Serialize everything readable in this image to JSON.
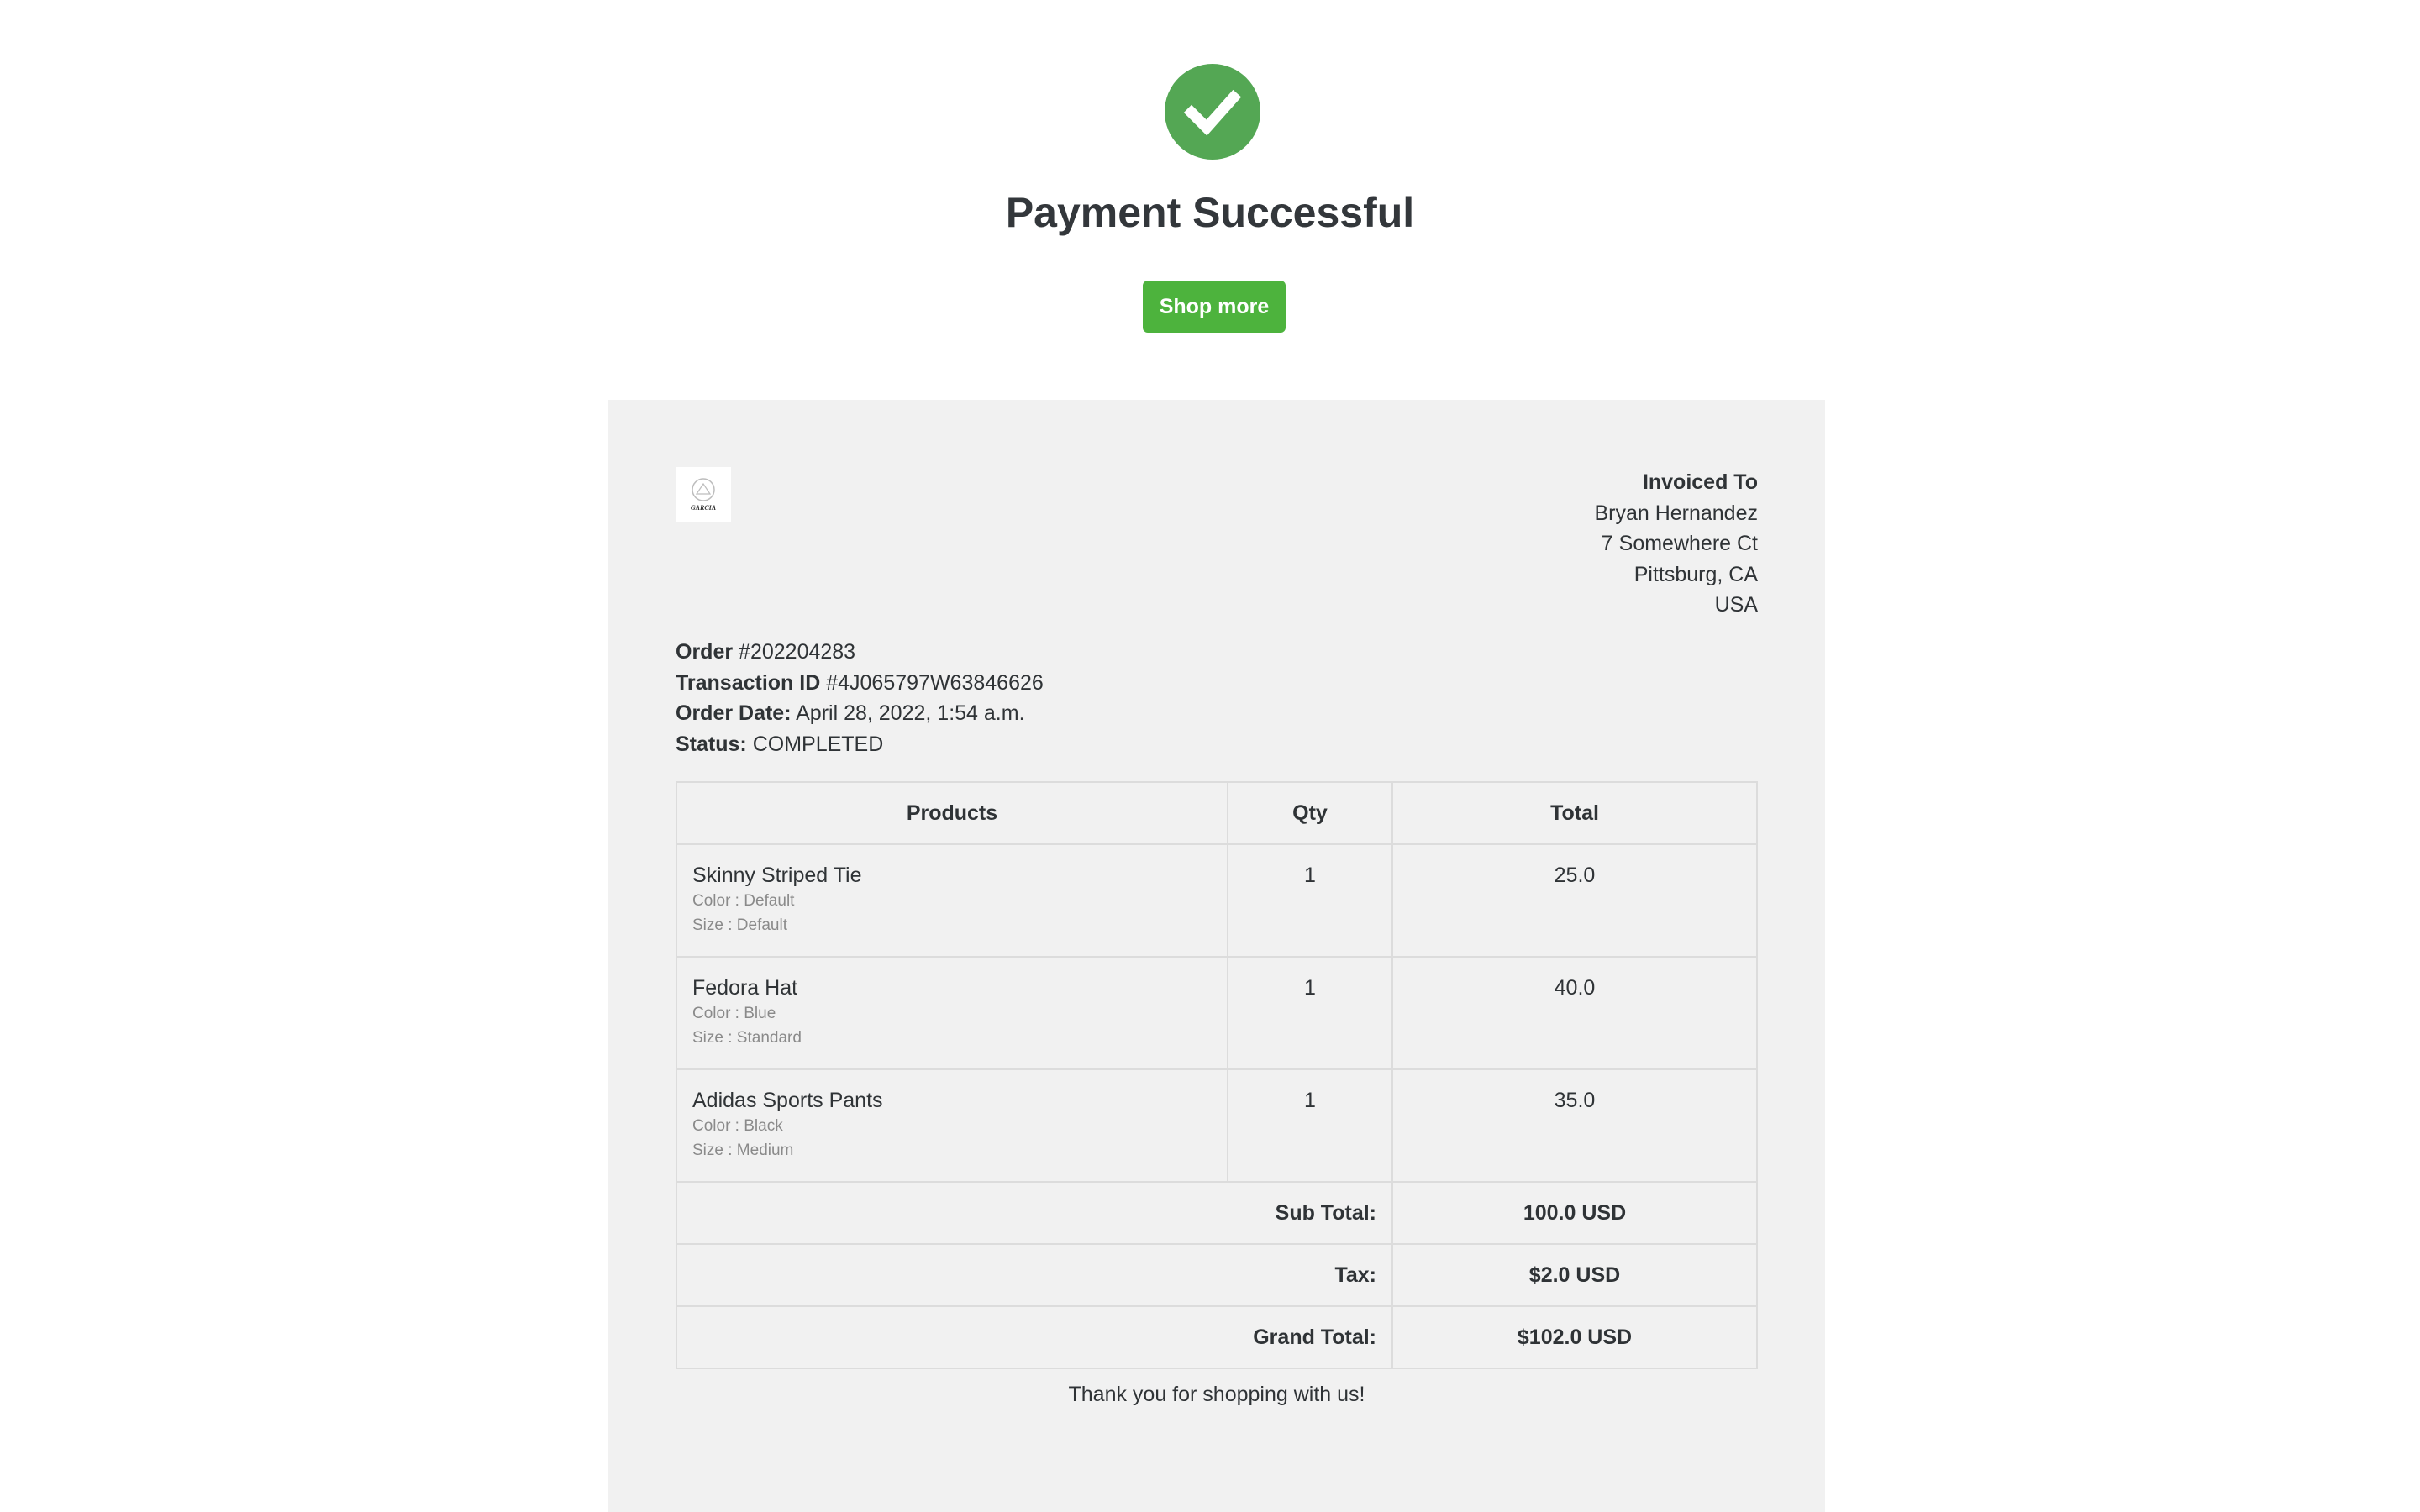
{
  "header": {
    "title": "Payment Successful",
    "shop_more_label": "Shop more",
    "success_icon": "check-circle-icon",
    "success_color": "#54a754",
    "button_color": "#4db33d"
  },
  "invoice": {
    "logo_text": "GARCIA",
    "invoiced_to": {
      "heading": "Invoiced To",
      "name": "Bryan Hernandez",
      "street": "7 Somewhere Ct",
      "city": "Pittsburg, CA",
      "country": "USA"
    },
    "order": {
      "order_label": "Order",
      "order_number": "#202204283",
      "transaction_label": "Transaction ID",
      "transaction_id": "#4J065797W63846626",
      "date_label": "Order Date:",
      "date": "April 28, 2022, 1:54 a.m.",
      "status_label": "Status:",
      "status": "COMPLETED"
    },
    "table": {
      "headers": {
        "products": "Products",
        "qty": "Qty",
        "total": "Total"
      },
      "rows": [
        {
          "name": "Skinny Striped Tie",
          "color": "Color : Default",
          "size": "Size : Default",
          "qty": "1",
          "total": "25.0"
        },
        {
          "name": "Fedora Hat",
          "color": "Color : Blue",
          "size": "Size : Standard",
          "qty": "1",
          "total": "40.0"
        },
        {
          "name": "Adidas Sports Pants",
          "color": "Color : Black",
          "size": "Size : Medium",
          "qty": "1",
          "total": "35.0"
        }
      ],
      "summary": {
        "subtotal_label": "Sub Total:",
        "subtotal": "100.0 USD",
        "tax_label": "Tax:",
        "tax": "$2.0 USD",
        "grand_total_label": "Grand Total:",
        "grand_total": "$102.0 USD"
      }
    },
    "thank_you": "Thank you for shopping with us!"
  }
}
